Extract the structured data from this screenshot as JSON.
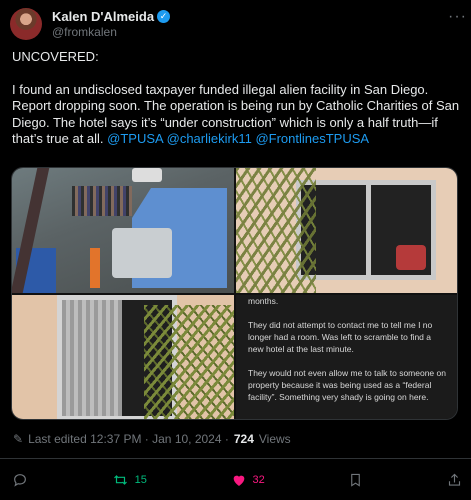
{
  "author": {
    "name": "Kalen D'Almeida",
    "handle": "@fromkalen",
    "verified": true
  },
  "tweet": {
    "heading": "UNCOVERED:",
    "body": "I found an undisclosed taxpayer funded illegal alien facility in San Diego. Report dropping soon. The operation is being run by Catholic Charities of San Diego. The hotel says it’s “under construction” which is only a half truth—if that’s true at all.",
    "mentions": [
      "@TPUSA",
      "@charliekirk11",
      "@FrontlinesTPUSA"
    ]
  },
  "media": {
    "screenshot_text": [
      "months.",
      "They did not attempt to contact me to tell me I no longer had a room. Was left to scramble to find a new hotel at the last minute.",
      "They would not even allow me to talk to someone on property because it was being used as a “federal facility”. Something very shady is going on here."
    ]
  },
  "meta": {
    "edited_label": "Last edited 12:37 PM · Jan 10, 2024 ·",
    "views_count": "724",
    "views_label": "Views"
  },
  "actions": {
    "reply_count": "",
    "retweet_count": "15",
    "like_count": "32"
  },
  "icons": {
    "verified": "verified-badge-icon",
    "more": "more-icon",
    "edit": "pencil-icon",
    "reply": "reply-icon",
    "retweet": "retweet-icon",
    "like": "heart-icon",
    "bookmark": "bookmark-icon",
    "share": "share-icon"
  },
  "colors": {
    "accent": "#1d9bf0",
    "retweet": "#00ba7c",
    "like": "#f91880",
    "background": "#000000"
  }
}
